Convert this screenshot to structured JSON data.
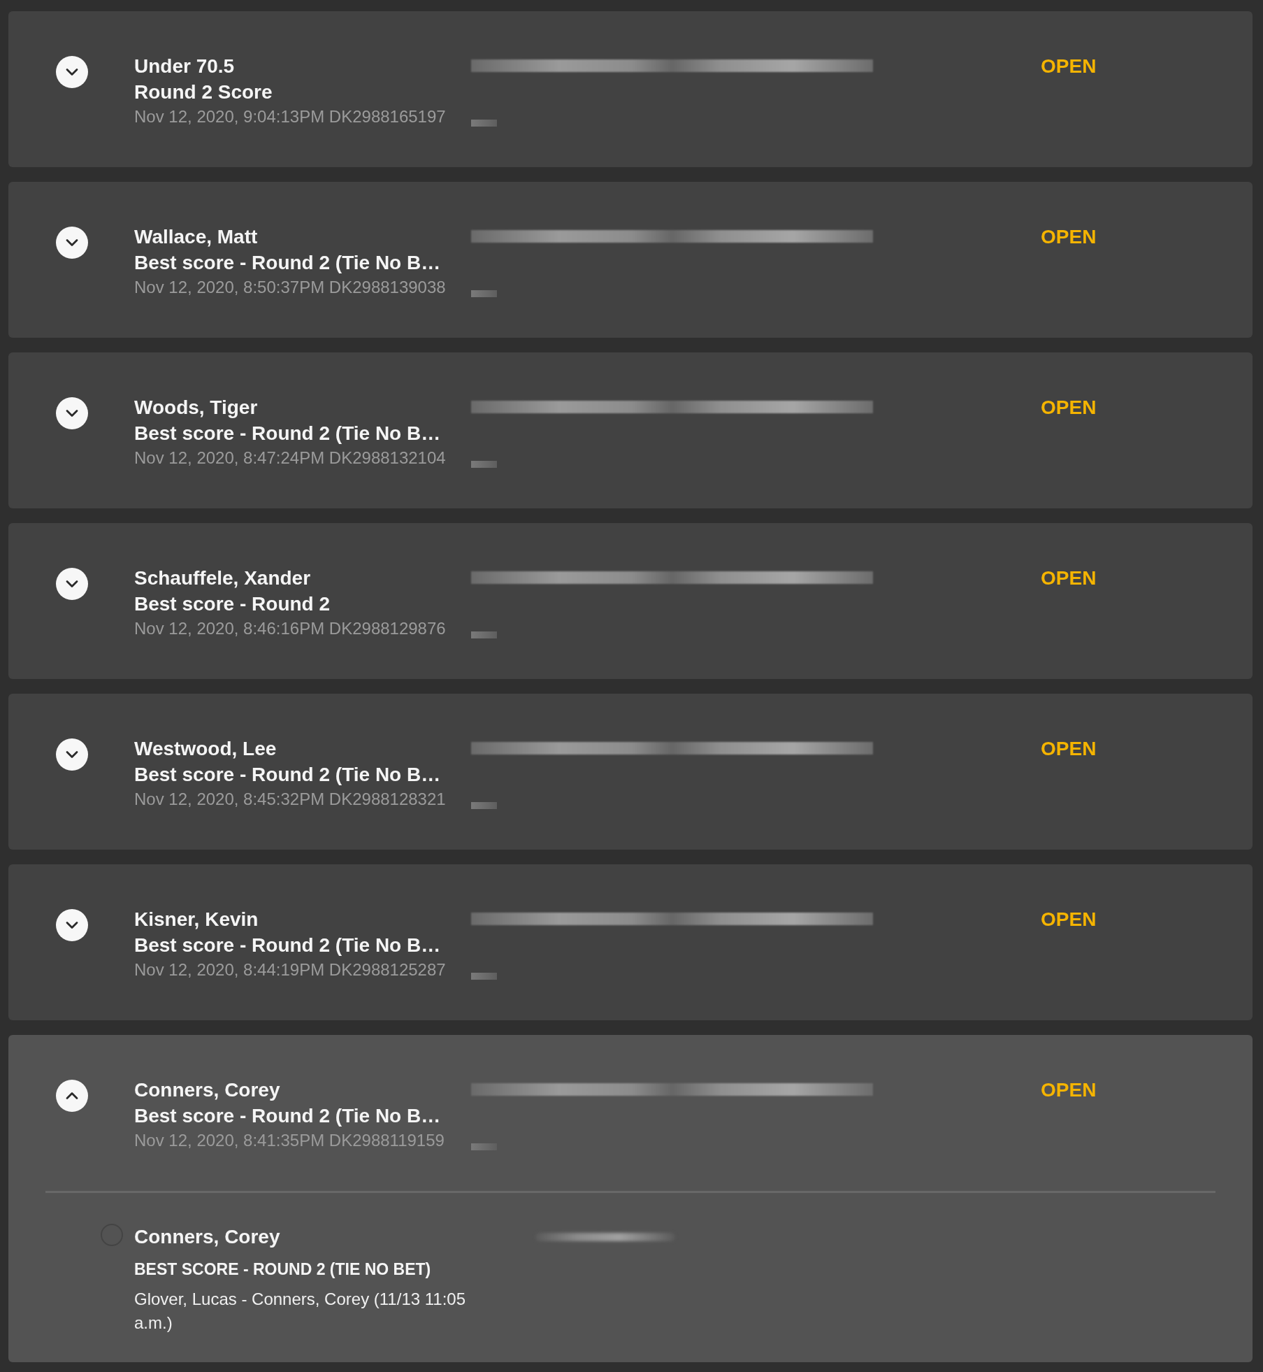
{
  "bets": [
    {
      "title": "Under 70.5",
      "subtitle": "Round 2 Score",
      "placed": "Nov 12, 2020, 9:04:13PM DK2988165197",
      "status": "OPEN",
      "expanded": false
    },
    {
      "title": "Wallace, Matt",
      "subtitle": "Best score - Round 2 (Tie No B…",
      "placed": "Nov 12, 2020, 8:50:37PM DK2988139038",
      "status": "OPEN",
      "expanded": false
    },
    {
      "title": "Woods, Tiger",
      "subtitle": "Best score - Round 2 (Tie No B…",
      "placed": "Nov 12, 2020, 8:47:24PM DK2988132104",
      "status": "OPEN",
      "expanded": false
    },
    {
      "title": "Schauffele, Xander",
      "subtitle": "Best score - Round 2",
      "placed": "Nov 12, 2020, 8:46:16PM DK2988129876",
      "status": "OPEN",
      "expanded": false
    },
    {
      "title": "Westwood, Lee",
      "subtitle": "Best score - Round 2 (Tie No B…",
      "placed": "Nov 12, 2020, 8:45:32PM DK2988128321",
      "status": "OPEN",
      "expanded": false
    },
    {
      "title": "Kisner, Kevin",
      "subtitle": "Best score - Round 2 (Tie No B…",
      "placed": "Nov 12, 2020, 8:44:19PM DK2988125287",
      "status": "OPEN",
      "expanded": false
    },
    {
      "title": "Conners, Corey",
      "subtitle": "Best score - Round 2 (Tie No B…",
      "placed": "Nov 12, 2020, 8:41:35PM DK2988119159",
      "status": "OPEN",
      "expanded": true,
      "legs": [
        {
          "selection": "Conners, Corey",
          "market": "BEST SCORE - ROUND 2 (TIE NO BET)",
          "event": "Glover, Lucas - Conners, Corey (11/13 11:05 a.m.)"
        }
      ]
    }
  ]
}
